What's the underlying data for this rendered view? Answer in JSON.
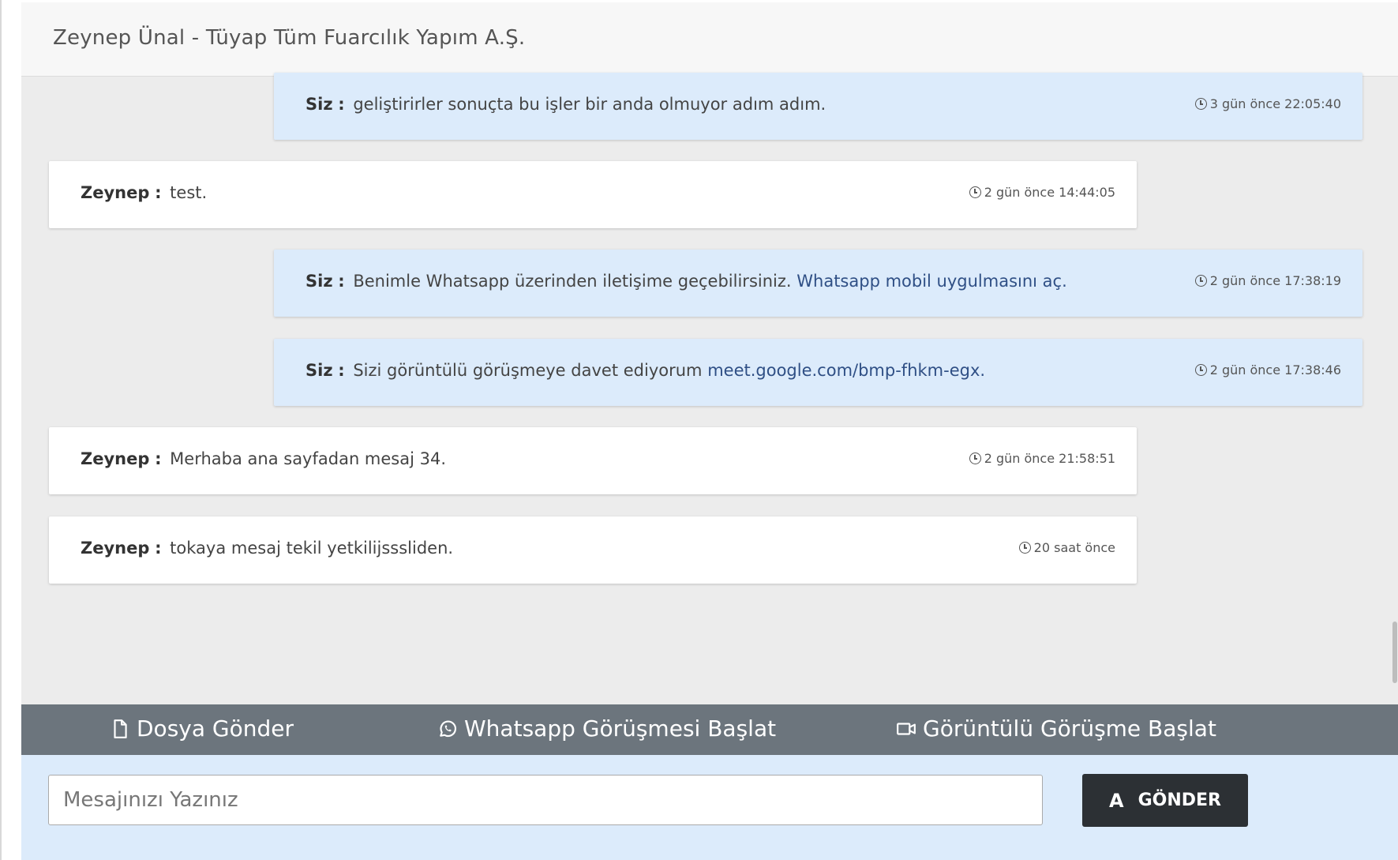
{
  "header": {
    "title": "Zeynep Ünal - Tüyap Tüm Fuarcılık Yapım A.Ş."
  },
  "messages": [
    {
      "side": "me",
      "sender": "Siz",
      "text": "geliştirirler sonuçta bu işler bir anda olmuyor adım adım.",
      "link": "",
      "time": "3 gün önce 22:05:40"
    },
    {
      "side": "them",
      "sender": "Zeynep",
      "text": "test.",
      "link": "",
      "time": "2 gün önce 14:44:05"
    },
    {
      "side": "me",
      "sender": "Siz",
      "text": "Benimle Whatsapp üzerinden iletişime geçebilirsiniz.",
      "link": "Whatsapp mobil uygulmasını aç.",
      "time": "2 gün önce 17:38:19"
    },
    {
      "side": "me",
      "sender": "Siz",
      "text": "Sizi görüntülü görüşmeye davet ediyorum",
      "link": "meet.google.com/bmp-fhkm-egx.",
      "time": "2 gün önce 17:38:46"
    },
    {
      "side": "them",
      "sender": "Zeynep",
      "text": "Merhaba ana sayfadan mesaj 34.",
      "link": "",
      "time": "2 gün önce 21:58:51"
    },
    {
      "side": "them",
      "sender": "Zeynep",
      "text": "tokaya mesaj tekil yetkilijsssliden.",
      "link": "",
      "time": "20 saat önce"
    }
  ],
  "separator": ":",
  "actions": {
    "file": "Dosya Gönder",
    "whatsapp": "Whatsapp Görüşmesi Başlat",
    "video": "Görüntülü Görüşme Başlat"
  },
  "composer": {
    "placeholder": "Mesajınızı Yazınız",
    "value": "",
    "send_label": "GÖNDER",
    "send_icon": "A"
  },
  "icons": {
    "clock": "clock-icon",
    "file": "file-icon",
    "whatsapp": "whatsapp-icon",
    "video": "video-camera-icon",
    "send": "send-icon"
  },
  "colors": {
    "my_bubble": "#dcebfb",
    "their_bubble": "#ffffff",
    "action_bar": "#6c757d",
    "send_button": "#2c3034",
    "link": "#2f4f85"
  }
}
